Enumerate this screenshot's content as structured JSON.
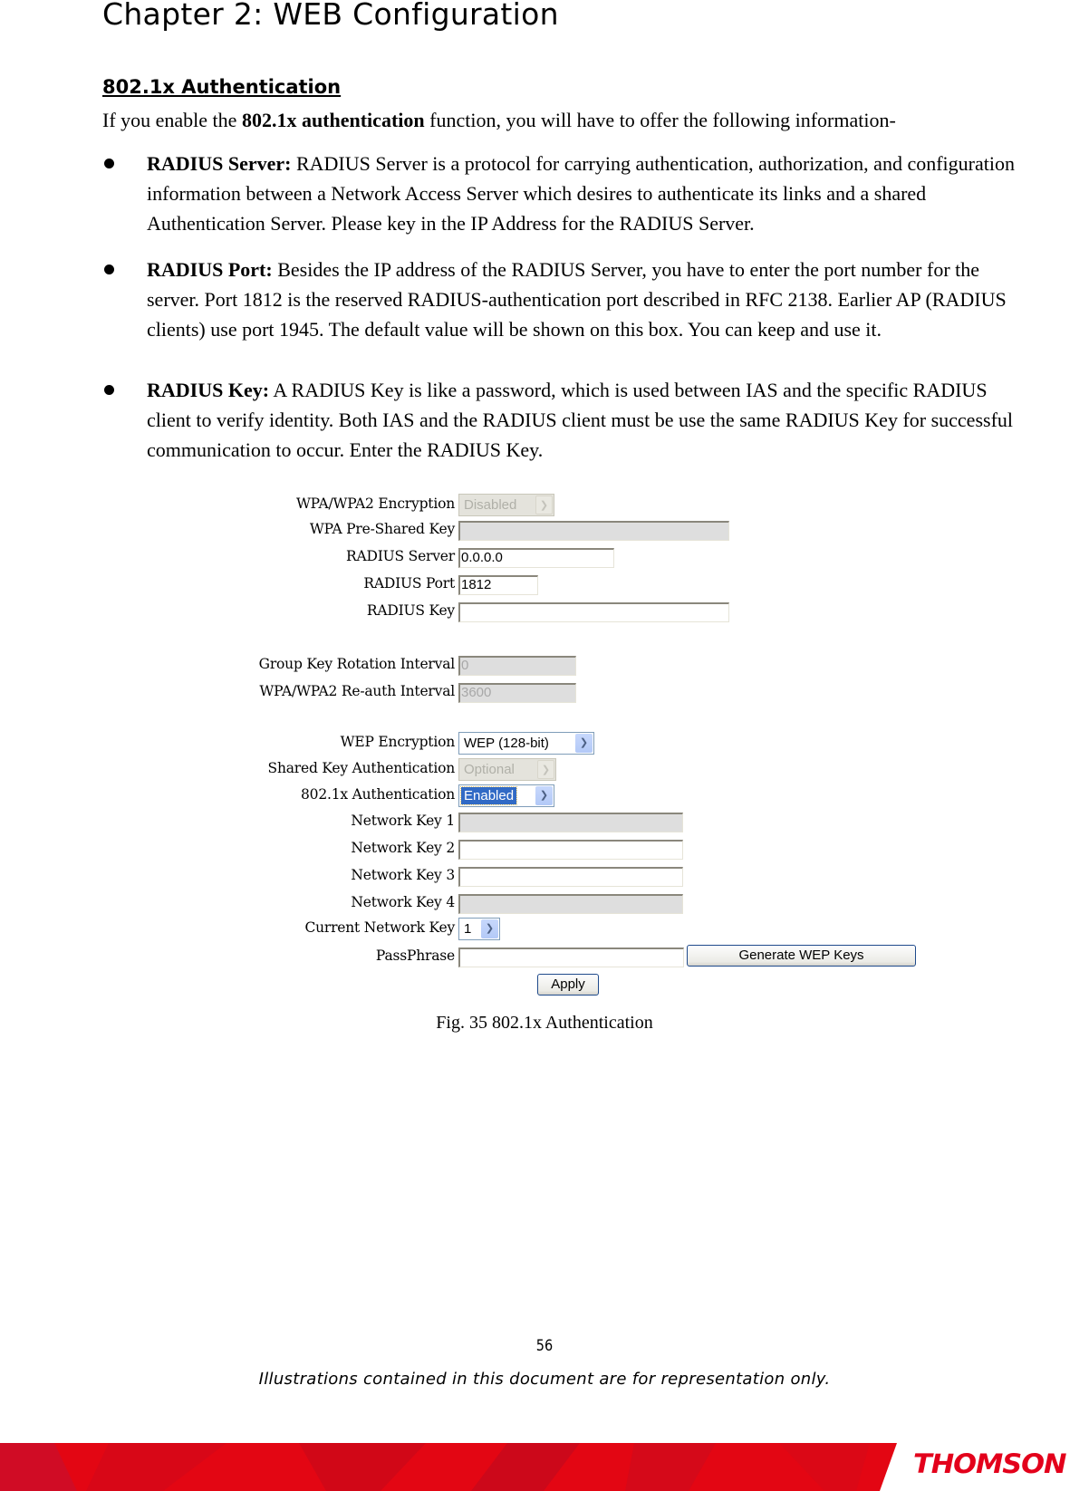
{
  "header": {
    "chapter_title": "Chapter 2: WEB Configuration"
  },
  "section": {
    "heading": "802.1x Authentication",
    "intro_prefix": "If you enable the ",
    "intro_bold": "802.1x authentication",
    "intro_suffix": " function, you will have to offer the following information-",
    "bullets": [
      {
        "term": "RADIUS Server:",
        "text": " RADIUS Server is a protocol for carrying authentication, authorization, and configuration information between a Network Access Server which desires to authenticate its links and a shared Authentication Server. Please key in the IP Address for the RADIUS Server."
      },
      {
        "term": "RADIUS Port:",
        "text": " Besides the IP address of the RADIUS Server, you have to enter the port number for the server. Port 1812 is the reserved RADIUS-authentication port described in RFC 2138. Earlier AP (RADIUS clients) use port 1945. The default value will be shown on this box. You can keep and use it."
      },
      {
        "term": "RADIUS Key:",
        "text": " A RADIUS Key is like a password, which is used between IAS and the specific RADIUS client to verify identity. Both IAS and the RADIUS client must be use the same RADIUS Key for successful communication to occur. Enter the RADIUS Key."
      }
    ]
  },
  "form": {
    "wpa_encryption": {
      "label": "WPA/WPA2 Encryption",
      "value": "Disabled"
    },
    "wpa_psk": {
      "label": "WPA Pre-Shared Key",
      "value": ""
    },
    "radius_server": {
      "label": "RADIUS Server",
      "value": "0.0.0.0"
    },
    "radius_port": {
      "label": "RADIUS Port",
      "value": "1812"
    },
    "radius_key": {
      "label": "RADIUS Key",
      "value": ""
    },
    "group_key_interval": {
      "label": "Group Key Rotation Interval",
      "value": "0"
    },
    "reauth_interval": {
      "label": "WPA/WPA2 Re-auth Interval",
      "value": "3600"
    },
    "wep_encryption": {
      "label": "WEP Encryption",
      "value": "WEP (128-bit)"
    },
    "shared_key_auth": {
      "label": "Shared Key Authentication",
      "value": "Optional"
    },
    "dot1x_auth": {
      "label": "802.1x Authentication",
      "value": "Enabled"
    },
    "network_key_1": {
      "label": "Network Key 1",
      "value": ""
    },
    "network_key_2": {
      "label": "Network Key 2",
      "value": ""
    },
    "network_key_3": {
      "label": "Network Key 3",
      "value": ""
    },
    "network_key_4": {
      "label": "Network Key 4",
      "value": ""
    },
    "current_network_key": {
      "label": "Current Network Key",
      "value": "1"
    },
    "passphrase": {
      "label": "PassPhrase",
      "value": ""
    },
    "generate_button": "Generate WEP Keys",
    "apply_button": "Apply",
    "dropdown_icon": "chevron-down-icon"
  },
  "figure_caption": "Fig. 35 802.1x Authentication",
  "footer": {
    "page_number": "56",
    "disclaimer": "Illustrations contained in this document are for representation only.",
    "brand": "THOMSON",
    "brand_color": "#e3001b",
    "band_color": "#e30613"
  }
}
